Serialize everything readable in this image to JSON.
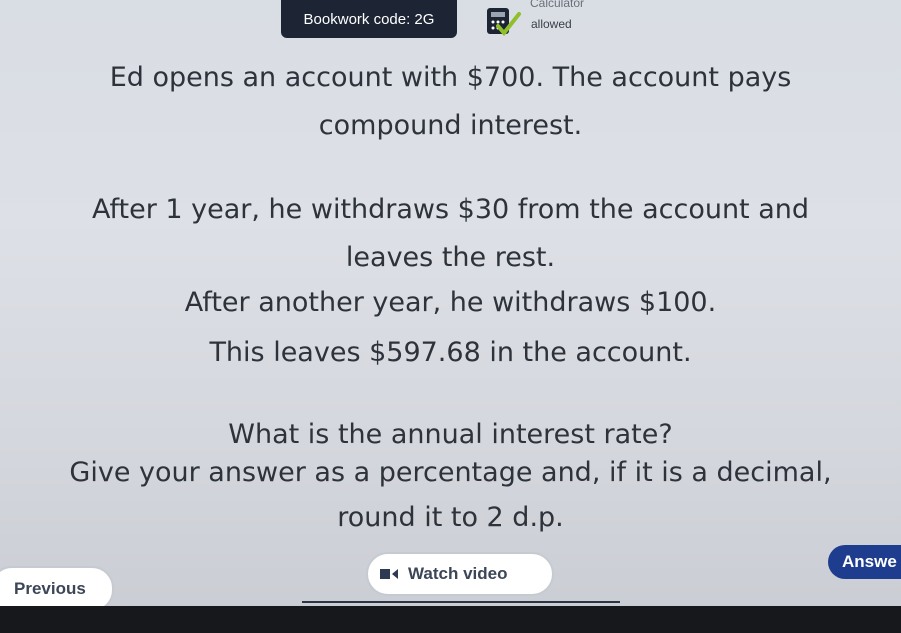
{
  "header": {
    "bookwork_code": "Bookwork code: 2G",
    "calculator_label": "Calculator",
    "calculator_status": "allowed"
  },
  "question": {
    "lines": [
      "Ed opens an account with $700. The account pays",
      "compound interest.",
      "After 1 year, he withdraws $30 from the account and",
      "leaves the rest.",
      "After another year, he withdraws $100.",
      "This leaves $597.68 in the account.",
      "What is the annual interest rate?",
      "Give your answer as a percentage and, if it is a decimal,",
      "round it to 2 d.p."
    ]
  },
  "footer": {
    "previous_label": "Previous",
    "watch_video_label": "Watch video",
    "answer_label": "Answe"
  },
  "colors": {
    "badge_bg": "#1d2535",
    "answer_bg": "#1f3d8f",
    "calculator_check": "#8fbf2a"
  }
}
